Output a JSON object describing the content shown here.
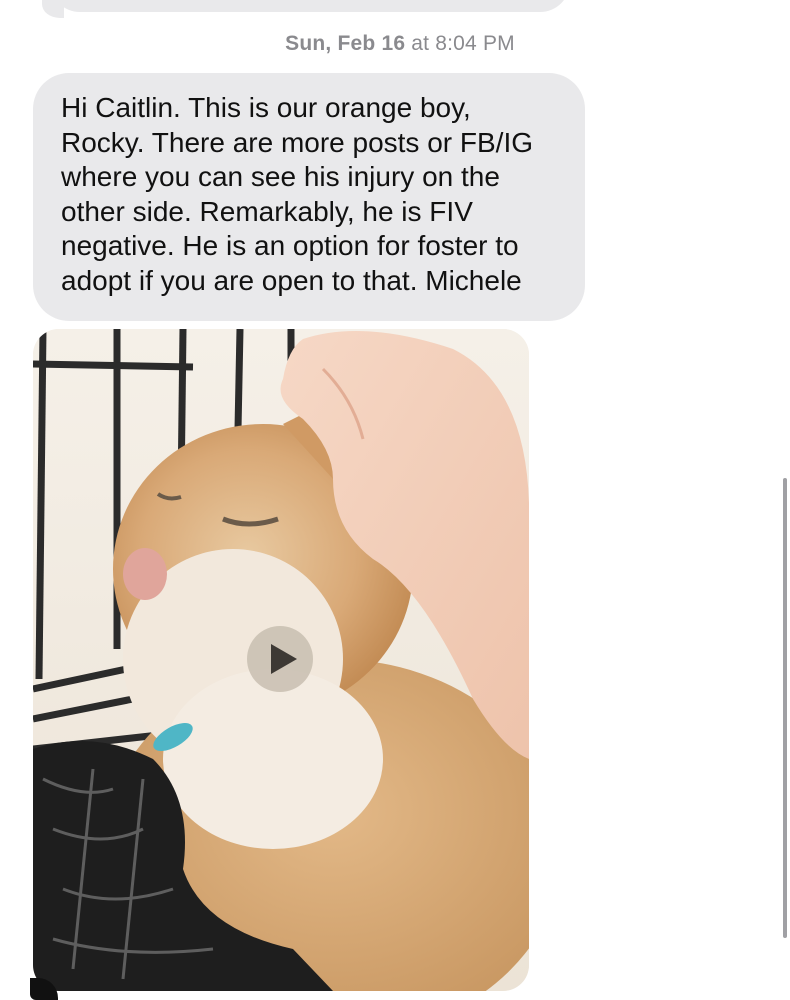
{
  "timestamp": {
    "day": "Sun, Feb 16",
    "at": "at",
    "time": "8:04 PM"
  },
  "message": {
    "lines": [
      "Hi Caitlin. This is our orange boy,",
      "Rocky. There are more posts or FB/IG",
      "where you can see his injury on the",
      "other side. Remarkably, he is FIV",
      "negative. He is an option for foster to",
      "adopt if you are open to that. Michele"
    ]
  },
  "media": {
    "type": "video",
    "play_icon": "play-icon"
  },
  "colors": {
    "incoming_bubble": "#e9e9eb",
    "timestamp": "#8a8a8e",
    "text": "#111111"
  }
}
